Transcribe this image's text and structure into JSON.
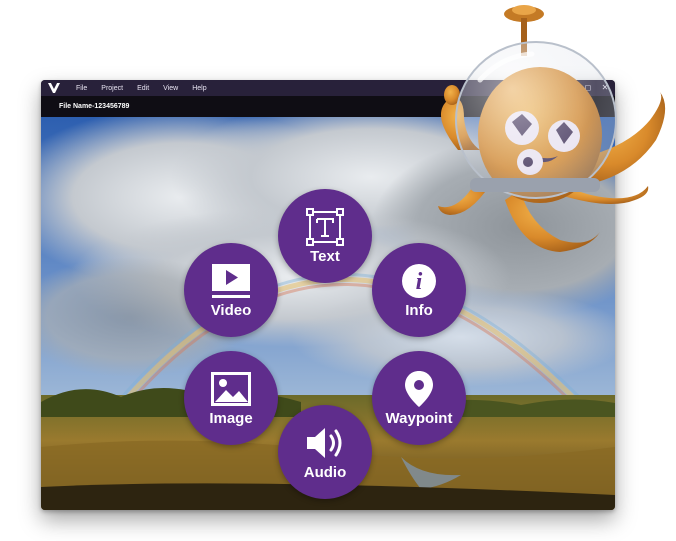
{
  "menu": {
    "items": [
      "File",
      "Project",
      "Edit",
      "View",
      "Help"
    ]
  },
  "window_controls": {
    "minimize": "–",
    "maximize": "◻",
    "close": "✕"
  },
  "document": {
    "file_name": "File Name-123456789"
  },
  "radial_menu": {
    "items": [
      {
        "label": "Text",
        "icon": "text-tool-icon"
      },
      {
        "label": "Info",
        "icon": "info-icon"
      },
      {
        "label": "Waypoint",
        "icon": "map-pin-icon"
      },
      {
        "label": "Audio",
        "icon": "speaker-icon"
      },
      {
        "label": "Image",
        "icon": "image-icon"
      },
      {
        "label": "Video",
        "icon": "video-player-icon"
      }
    ]
  },
  "colors": {
    "menu_bg": "#28213a",
    "title_bg": "#0f0d14",
    "accent_purple": "#5f2d8c",
    "mascot_orange": "#d98a2b"
  }
}
